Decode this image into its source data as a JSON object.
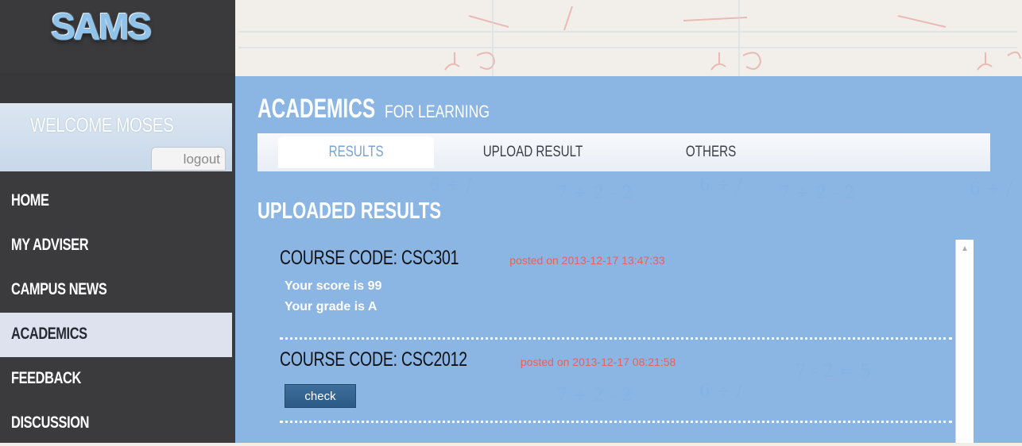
{
  "sidebar": {
    "logo_text": "SAMS",
    "welcome": "WELCOME MOSES",
    "logout_label": "logout",
    "items": [
      {
        "label": "HOME"
      },
      {
        "label": "MY ADVISER"
      },
      {
        "label": "CAMPUS NEWS"
      },
      {
        "label": "ACADEMICS",
        "active": true
      },
      {
        "label": "FEEDBACK"
      },
      {
        "label": "DISCUSSION"
      }
    ]
  },
  "main": {
    "title_main": "ACADEMICS",
    "title_sub": "FOR LEARNING",
    "tabs": [
      {
        "label": "RESULTS",
        "active": true
      },
      {
        "label": "UPLOAD RESULT"
      },
      {
        "label": "OTHERS"
      }
    ],
    "section_title": "UPLOADED RESULTS",
    "results": [
      {
        "course_code": "COURSE CODE: CSC301",
        "posted": "posted on 2013-12-17 13:47:33",
        "score": "Your score is 99",
        "grade": "Your grade is A"
      },
      {
        "course_code": "COURSE CODE: CSC2012",
        "posted": "posted on 2013-12-17 08:21:58",
        "button_label": "check"
      }
    ]
  },
  "colors": {
    "sidebar_bg": "#3b3b3e",
    "panel_blue": "#74aae2",
    "active_nav": "#dde2ee",
    "posted_red": "#e8605e",
    "check_button": "#2f5f8c"
  },
  "icons": {
    "scroll_up": "triangle-up-icon"
  }
}
